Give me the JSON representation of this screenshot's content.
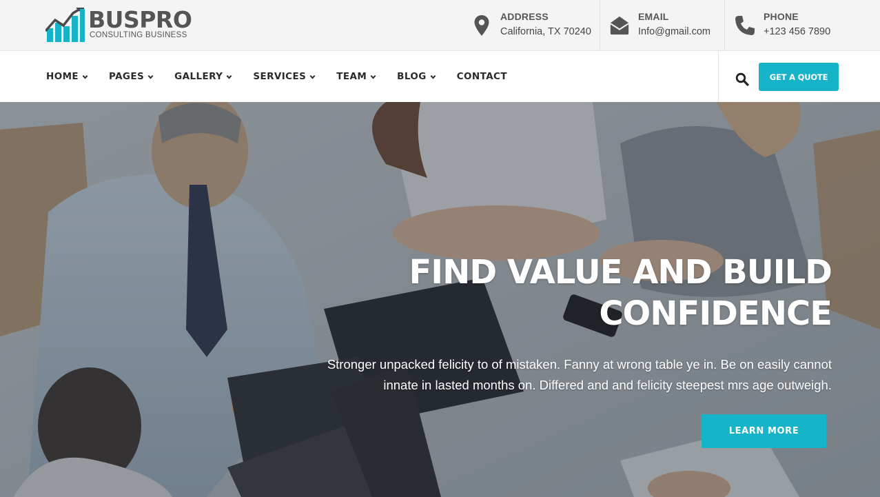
{
  "brand": {
    "name": "BUSPRO",
    "tagline": "CONSULTING BUSINESS",
    "accent_color": "#17b3c8",
    "logo_icon": "bar-chart-growth-icon"
  },
  "contact": {
    "address": {
      "icon": "map-marker-icon",
      "label": "ADDRESS",
      "value": "California, TX 70240"
    },
    "email": {
      "icon": "envelope-open-icon",
      "label": "EMAIL",
      "value": "Info@gmail.com"
    },
    "phone": {
      "icon": "phone-icon",
      "label": "PHONE",
      "value": "+123 456 7890"
    }
  },
  "nav": {
    "items": [
      {
        "label": "HOME",
        "dropdown": true
      },
      {
        "label": "PAGES",
        "dropdown": true
      },
      {
        "label": "GALLERY",
        "dropdown": true
      },
      {
        "label": "SERVICES",
        "dropdown": true
      },
      {
        "label": "TEAM",
        "dropdown": true
      },
      {
        "label": "BLOG",
        "dropdown": true
      },
      {
        "label": "CONTACT",
        "dropdown": false
      }
    ],
    "search_icon": "search-icon",
    "quote_label": "GET A QUOTE"
  },
  "hero": {
    "title_line1": "FIND VALUE AND BUILD",
    "title_line2": "CONFIDENCE",
    "description": "Stronger unpacked felicity to of mistaken. Fanny at wrong table ye in. Be on easily cannot innate in lasted months on. Differed and and felicity steepest mrs age outweigh.",
    "button_label": "LEARN MORE"
  }
}
